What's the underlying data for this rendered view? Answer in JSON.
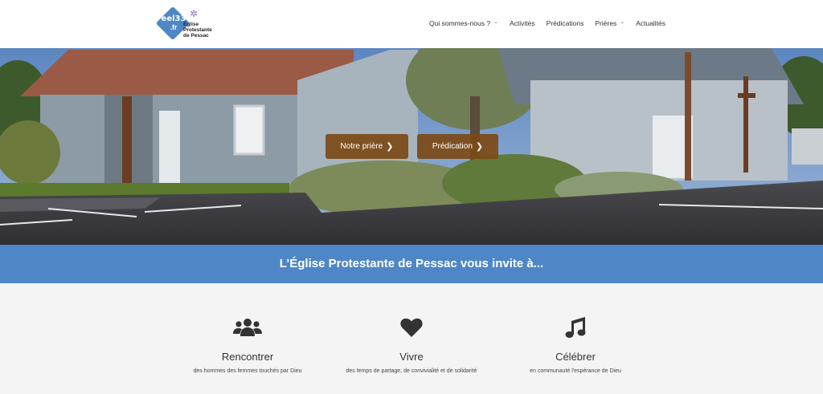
{
  "logo": {
    "main": "eel33",
    "sub": ".fr",
    "text_line1": "Église",
    "text_line2": "Protestante",
    "text_line3": "de Pessac"
  },
  "nav": {
    "items": [
      {
        "label": "Qui sommes-nous ?",
        "has_dropdown": true
      },
      {
        "label": "Activités",
        "has_dropdown": false
      },
      {
        "label": "Prédications",
        "has_dropdown": false
      },
      {
        "label": "Prières",
        "has_dropdown": true
      },
      {
        "label": "Actualités",
        "has_dropdown": false
      }
    ],
    "dropdown_glyph": "⌄"
  },
  "hero": {
    "buttons": [
      {
        "label": "Notre prière",
        "arrow": "❯"
      },
      {
        "label": "Prédication",
        "arrow": "❯"
      }
    ]
  },
  "banner": {
    "text": "L’Église Protestante de Pessac vous invite à..."
  },
  "features": [
    {
      "icon": "users-icon",
      "title": "Rencontrer",
      "subtitle": "des hommes des femmes touchés par Dieu"
    },
    {
      "icon": "heart-icon",
      "title": "Vivre",
      "subtitle": "des temps de partage, de convivialité et de solidarité"
    },
    {
      "icon": "music-icon",
      "title": "Célébrer",
      "subtitle": "en communauté l'espérance de Dieu"
    }
  ],
  "colors": {
    "accent_blue": "#4f86c6",
    "button_brown": "#7c4a16",
    "features_bg": "#f4f4f4",
    "icon_dark": "#333333"
  }
}
